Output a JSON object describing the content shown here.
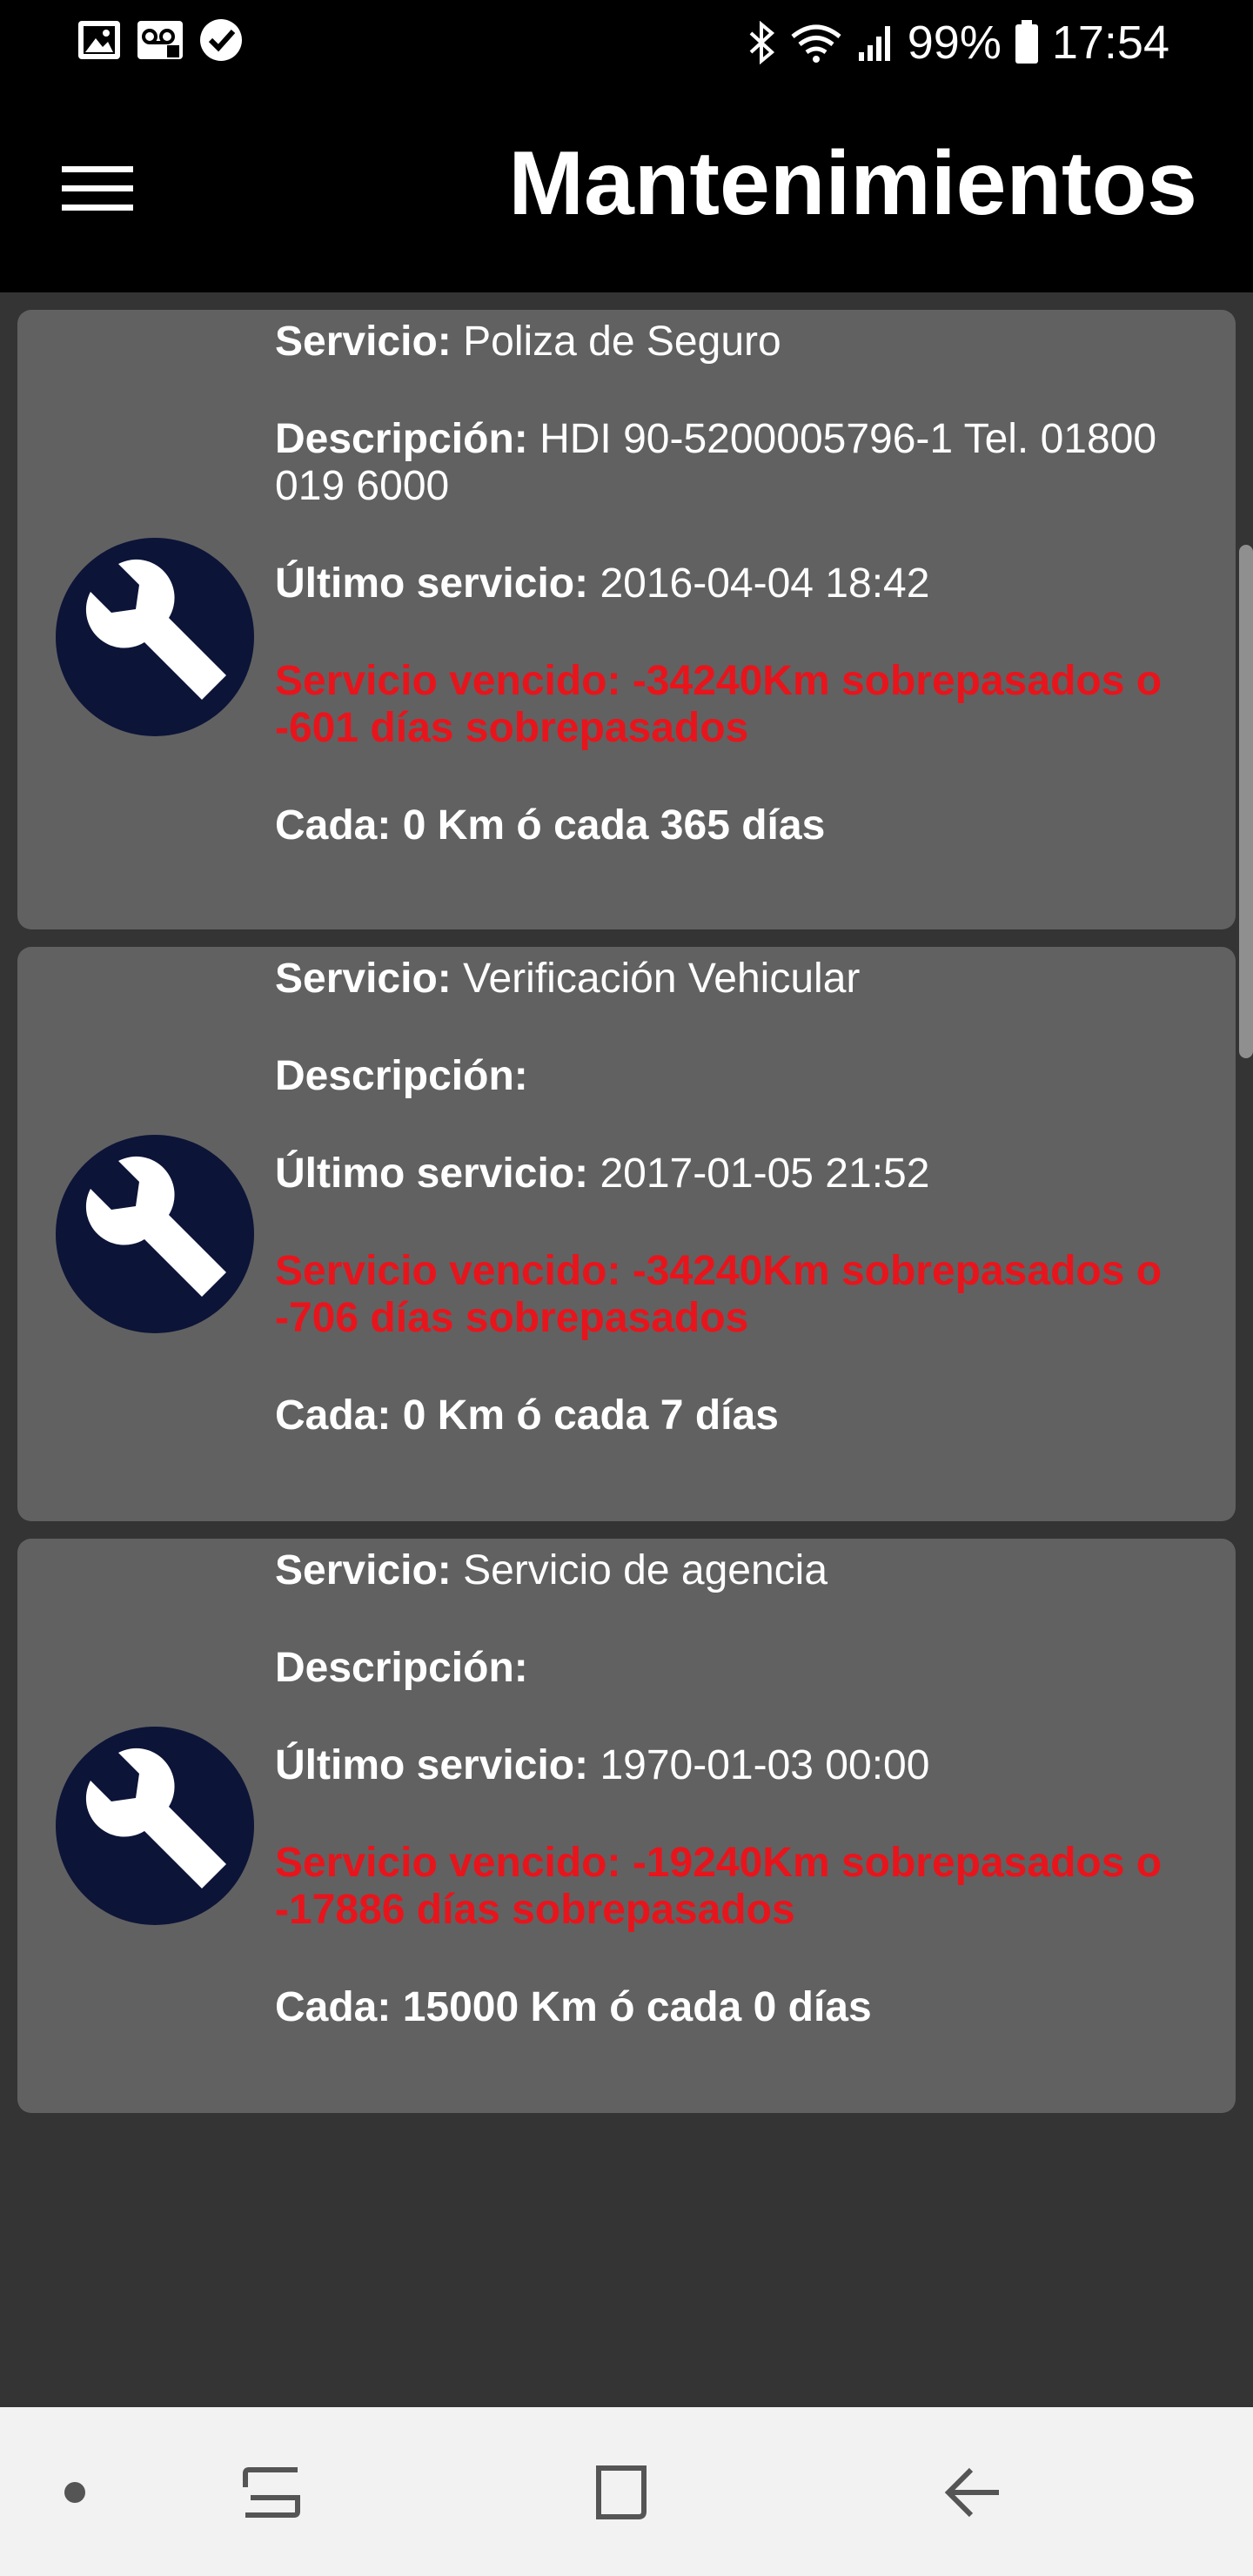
{
  "status_bar": {
    "battery": "99%",
    "time": "17:54"
  },
  "app_bar": {
    "title": "Mantenimientos"
  },
  "labels": {
    "service": "Servicio:",
    "description": "Descripción:",
    "last_service": "Último servicio:"
  },
  "services": [
    {
      "service": "Poliza de Seguro",
      "description": "HDI 90-5200005796-1 Tel. 01800 019 6000",
      "last_service": "2016-04-04 18:42",
      "overdue": "Servicio vencido: -34240Km sobrepasados o -601 días sobrepasados",
      "interval": "Cada: 0 Km ó cada 365 días"
    },
    {
      "service": "Verificación Vehicular",
      "description": "",
      "last_service": "2017-01-05 21:52",
      "overdue": "Servicio vencido: -34240Km sobrepasados o -706 días sobrepasados",
      "interval": "Cada: 0 Km ó cada 7 días"
    },
    {
      "service": "Servicio de agencia",
      "description": "",
      "last_service": "1970-01-03 00:00",
      "overdue": "Servicio vencido: -19240Km sobrepasados o -17886 días sobrepasados",
      "interval": "Cada: 15000 Km ó cada 0 días"
    }
  ],
  "colors": {
    "card_bg": "#616161",
    "overdue_text": "#e8141c",
    "icon_circle": "#0c1438"
  }
}
